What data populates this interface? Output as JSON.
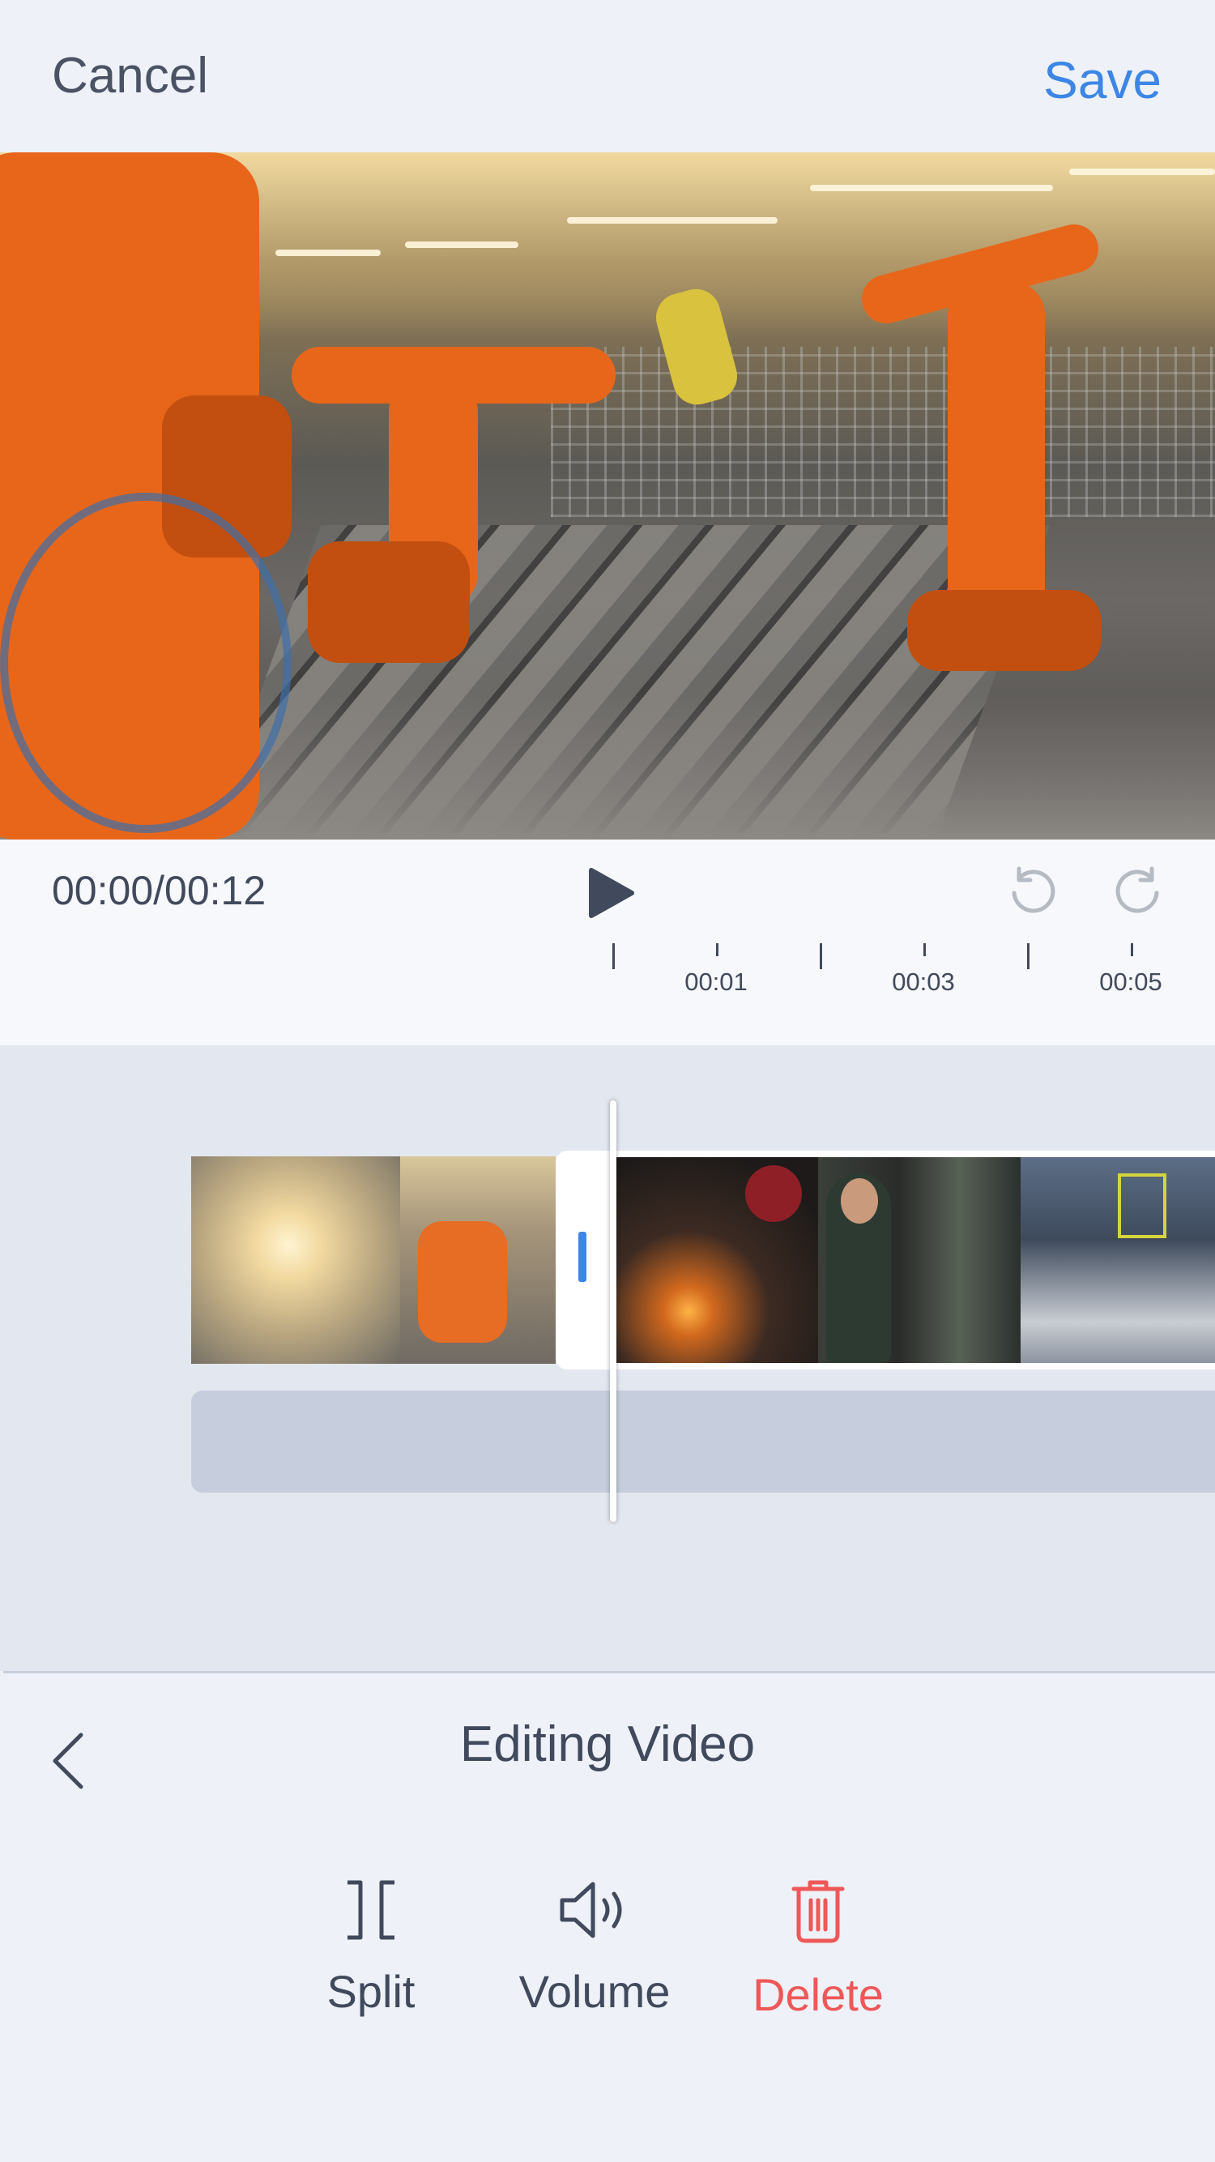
{
  "header": {
    "cancel_label": "Cancel",
    "save_label": "Save"
  },
  "player": {
    "time": "00:00/00:12",
    "ruler": [
      "00:01",
      "00:03",
      "00:05"
    ]
  },
  "panel": {
    "title": "Editing Video",
    "tools": [
      {
        "label": "Split",
        "icon": "split-icon"
      },
      {
        "label": "Volume",
        "icon": "volume-icon"
      },
      {
        "label": "Delete",
        "icon": "trash-icon"
      }
    ]
  },
  "colors": {
    "accent": "#3d86e6",
    "danger": "#ee5858",
    "text": "#414a5c"
  }
}
